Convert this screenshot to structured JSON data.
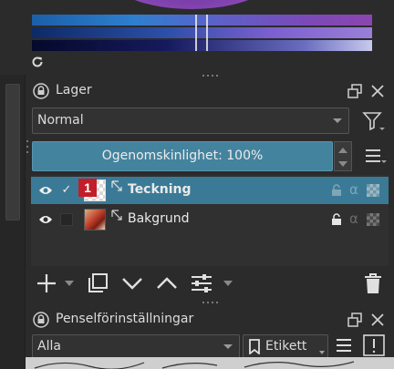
{
  "color_selector": {
    "icons": {
      "reset": "refresh-icon"
    },
    "colors": {
      "hue": "#2e7fcf",
      "saturation": "#2e4fa8",
      "value": "#161a5e",
      "accent": "#7a3ea8"
    }
  },
  "layers_docker": {
    "title": "Lager",
    "blend_mode": "Normal",
    "opacity_label": "Ogenomskinlighet:  100%",
    "layers": [
      {
        "name": "Teckning",
        "visible": true,
        "checked": true,
        "selected": true,
        "badge": "1"
      },
      {
        "name": "Bakgrund",
        "visible": true,
        "checked": false,
        "selected": false,
        "locked": true
      }
    ],
    "toolbar": [
      "add-icon",
      "duplicate-icon",
      "move-down-icon",
      "move-up-icon",
      "properties-icon",
      "delete-icon"
    ],
    "colors": {
      "selection": "#3b7a96",
      "opacity_bar": "#44839e"
    }
  },
  "brush_presets_docker": {
    "title": "Penselförinställningar",
    "filter": "Alla",
    "tag_button": "Etikett"
  }
}
